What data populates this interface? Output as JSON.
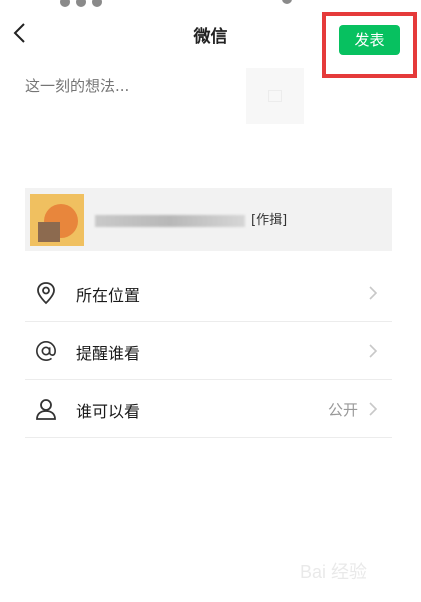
{
  "nav": {
    "title": "微信",
    "publish_label": "发表"
  },
  "compose": {
    "placeholder": "这一刻的想法..."
  },
  "share_card": {
    "text_suffix": "[作揖]"
  },
  "menu": {
    "items": [
      {
        "label": "所在位置",
        "value": "",
        "icon": "location-pin-icon"
      },
      {
        "label": "提醒谁看",
        "value": "",
        "icon": "at-sign-icon"
      },
      {
        "label": "谁可以看",
        "value": "公开",
        "icon": "person-icon"
      }
    ]
  },
  "colors": {
    "accent": "#07c160",
    "highlight_box": "#e53a3a",
    "card_bg": "#f2f2f2"
  },
  "watermark": {
    "text": "Bai 经验"
  }
}
